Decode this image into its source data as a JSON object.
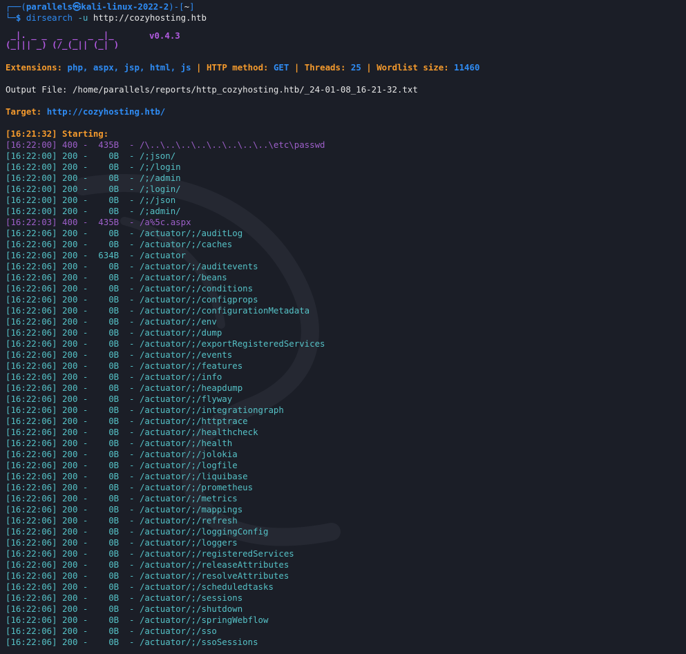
{
  "prompt": {
    "corner": "┌──(",
    "user_host": "parallels㉿kali-linux-2022-2",
    "mid": ")-[",
    "cwd": "~",
    "end": "]",
    "line2_prefix": "└─",
    "dollar": "$",
    "cmd": "dirsearch",
    "flag": "-u",
    "url": "http://cozyhosting.htb"
  },
  "banner": {
    "art_line1": " _|. _ _  _  _  _ _|_",
    "art_line2": "(_||| _) (/_(_|| (_| )",
    "version": "v0.4.3"
  },
  "config": {
    "ext_label": "Extensions:",
    "ext_value": "php, aspx, jsp, html, js",
    "sep": " | ",
    "method_label": "HTTP method:",
    "method_value": "GET",
    "threads_label": "Threads:",
    "threads_value": "25",
    "wordlist_label": "Wordlist size:",
    "wordlist_value": "11460"
  },
  "output_file": "Output File: /home/parallels/reports/http_cozyhosting.htb/_24-01-08_16-21-32.txt",
  "target": {
    "label": "Target:",
    "value": "http://cozyhosting.htb/"
  },
  "starting": "[16:21:32] Starting:",
  "results": [
    {
      "text": "[16:22:00] 400 -  435B  - /\\..\\..\\..\\..\\..\\..\\..\\..\\etc\\passwd",
      "type": "err"
    },
    {
      "text": "[16:22:00] 200 -    0B  - /;json/",
      "type": "ok"
    },
    {
      "text": "[16:22:00] 200 -    0B  - /;/login",
      "type": "ok"
    },
    {
      "text": "[16:22:00] 200 -    0B  - /;/admin",
      "type": "ok"
    },
    {
      "text": "[16:22:00] 200 -    0B  - /;login/",
      "type": "ok"
    },
    {
      "text": "[16:22:00] 200 -    0B  - /;/json",
      "type": "ok"
    },
    {
      "text": "[16:22:00] 200 -    0B  - /;admin/",
      "type": "ok"
    },
    {
      "text": "[16:22:03] 400 -  435B  - /a%5c.aspx",
      "type": "err"
    },
    {
      "text": "[16:22:06] 200 -    0B  - /actuator/;/auditLog",
      "type": "ok"
    },
    {
      "text": "[16:22:06] 200 -    0B  - /actuator/;/caches",
      "type": "ok"
    },
    {
      "text": "[16:22:06] 200 -  634B  - /actuator",
      "type": "ok"
    },
    {
      "text": "[16:22:06] 200 -    0B  - /actuator/;/auditevents",
      "type": "ok"
    },
    {
      "text": "[16:22:06] 200 -    0B  - /actuator/;/beans",
      "type": "ok"
    },
    {
      "text": "[16:22:06] 200 -    0B  - /actuator/;/conditions",
      "type": "ok"
    },
    {
      "text": "[16:22:06] 200 -    0B  - /actuator/;/configprops",
      "type": "ok"
    },
    {
      "text": "[16:22:06] 200 -    0B  - /actuator/;/configurationMetadata",
      "type": "ok"
    },
    {
      "text": "[16:22:06] 200 -    0B  - /actuator/;/env",
      "type": "ok"
    },
    {
      "text": "[16:22:06] 200 -    0B  - /actuator/;/dump",
      "type": "ok"
    },
    {
      "text": "[16:22:06] 200 -    0B  - /actuator/;/exportRegisteredServices",
      "type": "ok"
    },
    {
      "text": "[16:22:06] 200 -    0B  - /actuator/;/events",
      "type": "ok"
    },
    {
      "text": "[16:22:06] 200 -    0B  - /actuator/;/features",
      "type": "ok"
    },
    {
      "text": "[16:22:06] 200 -    0B  - /actuator/;/info",
      "type": "ok"
    },
    {
      "text": "[16:22:06] 200 -    0B  - /actuator/;/heapdump",
      "type": "ok"
    },
    {
      "text": "[16:22:06] 200 -    0B  - /actuator/;/flyway",
      "type": "ok"
    },
    {
      "text": "[16:22:06] 200 -    0B  - /actuator/;/integrationgraph",
      "type": "ok"
    },
    {
      "text": "[16:22:06] 200 -    0B  - /actuator/;/httptrace",
      "type": "ok"
    },
    {
      "text": "[16:22:06] 200 -    0B  - /actuator/;/healthcheck",
      "type": "ok"
    },
    {
      "text": "[16:22:06] 200 -    0B  - /actuator/;/health",
      "type": "ok"
    },
    {
      "text": "[16:22:06] 200 -    0B  - /actuator/;/jolokia",
      "type": "ok"
    },
    {
      "text": "[16:22:06] 200 -    0B  - /actuator/;/logfile",
      "type": "ok"
    },
    {
      "text": "[16:22:06] 200 -    0B  - /actuator/;/liquibase",
      "type": "ok"
    },
    {
      "text": "[16:22:06] 200 -    0B  - /actuator/;/prometheus",
      "type": "ok"
    },
    {
      "text": "[16:22:06] 200 -    0B  - /actuator/;/metrics",
      "type": "ok"
    },
    {
      "text": "[16:22:06] 200 -    0B  - /actuator/;/mappings",
      "type": "ok"
    },
    {
      "text": "[16:22:06] 200 -    0B  - /actuator/;/refresh",
      "type": "ok"
    },
    {
      "text": "[16:22:06] 200 -    0B  - /actuator/;/loggingConfig",
      "type": "ok"
    },
    {
      "text": "[16:22:06] 200 -    0B  - /actuator/;/loggers",
      "type": "ok"
    },
    {
      "text": "[16:22:06] 200 -    0B  - /actuator/;/registeredServices",
      "type": "ok"
    },
    {
      "text": "[16:22:06] 200 -    0B  - /actuator/;/releaseAttributes",
      "type": "ok"
    },
    {
      "text": "[16:22:06] 200 -    0B  - /actuator/;/resolveAttributes",
      "type": "ok"
    },
    {
      "text": "[16:22:06] 200 -    0B  - /actuator/;/scheduledtasks",
      "type": "ok"
    },
    {
      "text": "[16:22:06] 200 -    0B  - /actuator/;/sessions",
      "type": "ok"
    },
    {
      "text": "[16:22:06] 200 -    0B  - /actuator/;/shutdown",
      "type": "ok"
    },
    {
      "text": "[16:22:06] 200 -    0B  - /actuator/;/springWebflow",
      "type": "ok"
    },
    {
      "text": "[16:22:06] 200 -    0B  - /actuator/;/sso",
      "type": "ok"
    },
    {
      "text": "[16:22:06] 200 -    0B  - /actuator/;/ssoSessions",
      "type": "ok"
    }
  ]
}
